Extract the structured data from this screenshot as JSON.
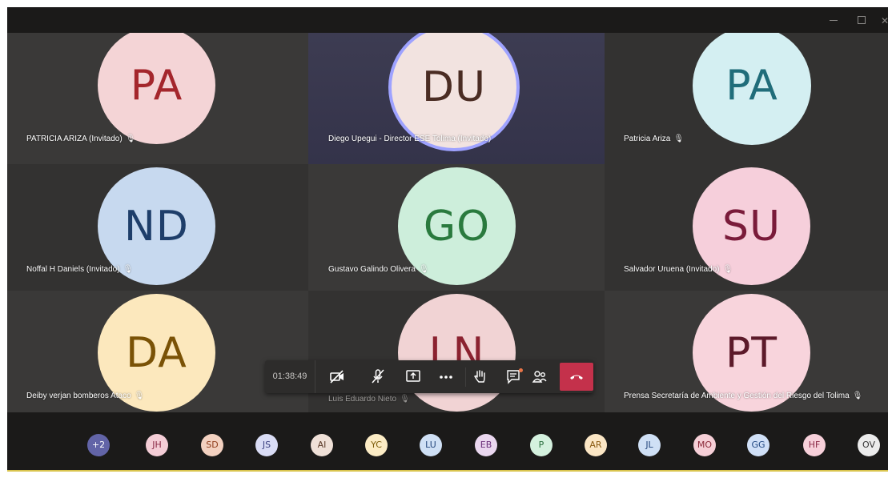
{
  "tiles": [
    {
      "initials": "PA",
      "label": "PATRICIA ARIZA (Invitado)",
      "bg": "#f4d4d6",
      "fg": "#a4262c"
    },
    {
      "initials": "DU",
      "label": "Diego Upegui - Director ESE Tolima (Invitado)",
      "bg": "#f2e3e0",
      "fg": "#4a2c23"
    },
    {
      "initials": "PA",
      "label": "Patricia Ariza",
      "bg": "#d4eff2",
      "fg": "#206d7a"
    },
    {
      "initials": "ND",
      "label": "Noffal H Daniels (Invitado)",
      "bg": "#c7d9ef",
      "fg": "#1e3e6a"
    },
    {
      "initials": "GO",
      "label": "Gustavo Galindo Olivera",
      "bg": "#cdeedb",
      "fg": "#2a7a3e"
    },
    {
      "initials": "SU",
      "label": "Salvador Uruena (Invitado)",
      "bg": "#f6cfdb",
      "fg": "#7a1b3a"
    },
    {
      "initials": "DA",
      "label": "Deiby verjan bomberos Ataco",
      "bg": "#fce8bd",
      "fg": "#7a5206"
    },
    {
      "initials": "LN",
      "label": "Luis Eduardo Nieto",
      "bg": "#f1d3d4",
      "fg": "#8b2230"
    },
    {
      "initials": "PT",
      "label": "Prensa Secretaría de Ambiente y Gestión del Riesgo del Tolima",
      "bg": "#f8d4dc",
      "fg": "#5c1a2a"
    }
  ],
  "controls": {
    "timer": "01:38:49",
    "camera": "camera-off-icon",
    "mic": "mic-off-icon",
    "share": "share-screen-icon",
    "more": "more-options-icon",
    "hand": "raise-hand-icon",
    "chat": "chat-icon",
    "people": "participants-icon",
    "hangup": "hang-up-icon",
    "hangup_color": "#c4314b"
  },
  "strip": [
    {
      "label": "+2",
      "bg": "#6264a7",
      "fg": "#ffffff"
    },
    {
      "label": "JH",
      "bg": "#f4cdd6",
      "fg": "#8b2a47"
    },
    {
      "label": "SD",
      "bg": "#f3d1c0",
      "fg": "#8f3d1b"
    },
    {
      "label": "JS",
      "bg": "#d9dcf5",
      "fg": "#3c4282"
    },
    {
      "label": "AI",
      "bg": "#efe0d7",
      "fg": "#5c3b2a"
    },
    {
      "label": "YC",
      "bg": "#fcecc5",
      "fg": "#7a5a08"
    },
    {
      "label": "LU",
      "bg": "#cfe0f5",
      "fg": "#25477d"
    },
    {
      "label": "EB",
      "bg": "#ead7ef",
      "fg": "#6a2f7a"
    },
    {
      "label": "P",
      "bg": "#d4f1de",
      "fg": "#2a6f3e"
    },
    {
      "label": "AR",
      "bg": "#fbe6c5",
      "fg": "#8a5a12"
    },
    {
      "label": "JL",
      "bg": "#cfe0f5",
      "fg": "#25477d"
    },
    {
      "label": "MO",
      "bg": "#f6cfd7",
      "fg": "#8b2a3a"
    },
    {
      "label": "GG",
      "bg": "#d0e0f7",
      "fg": "#1f4680"
    },
    {
      "label": "HF",
      "bg": "#f7d0da",
      "fg": "#8b2a47"
    },
    {
      "label": "OV",
      "bg": "#ececec",
      "fg": "#333333"
    }
  ]
}
